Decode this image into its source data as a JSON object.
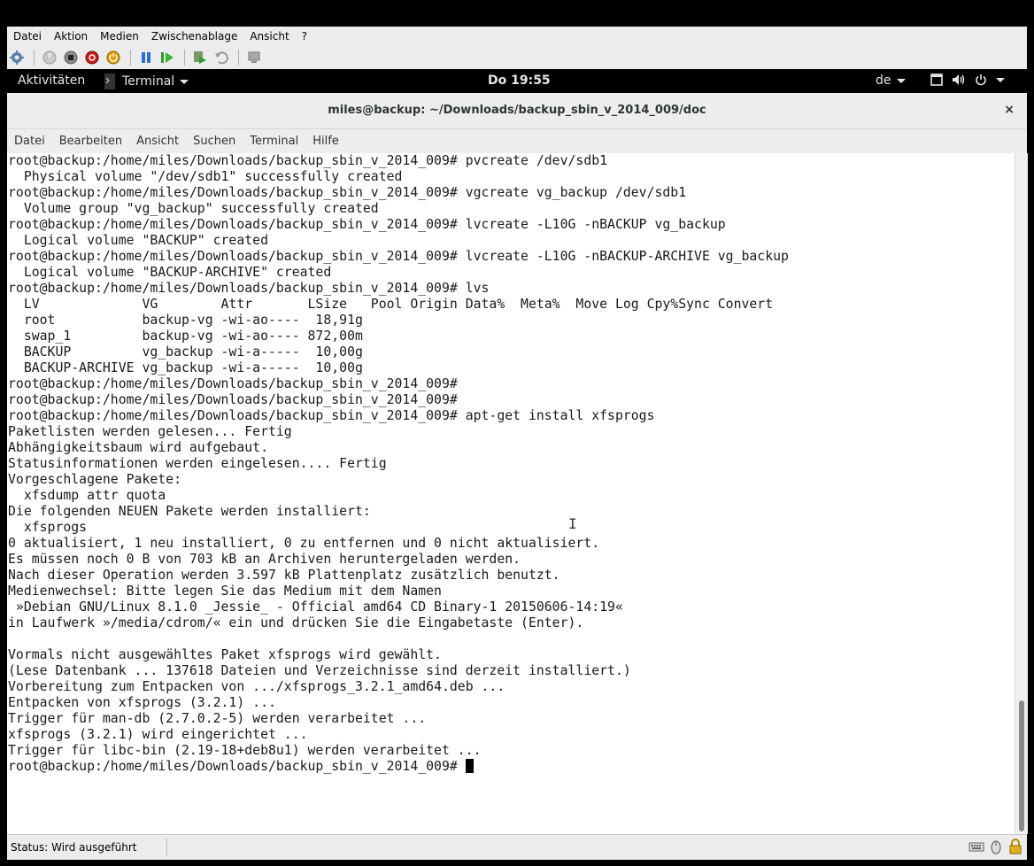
{
  "vm": {
    "menu": [
      "Datei",
      "Aktion",
      "Medien",
      "Zwischenablage",
      "Ansicht",
      "?"
    ],
    "toolbar_icons": [
      "settings-icon",
      "start-icon",
      "stop-icon",
      "shutdown-icon",
      "power-icon",
      "pause-icon",
      "resume-icon",
      "checkpoint-icon",
      "revert-icon",
      "share-icon"
    ],
    "status": "Status: Wird ausgeführt"
  },
  "gnome": {
    "activities": "Aktivitäten",
    "app_menu": "Terminal",
    "clock": "Do 19:55",
    "keyboard_layout": "de"
  },
  "window": {
    "title": "miles@backup: ~/Downloads/backup_sbin_v_2014_009/doc",
    "close": "×"
  },
  "terminal": {
    "menu": [
      "Datei",
      "Bearbeiten",
      "Ansicht",
      "Suchen",
      "Terminal",
      "Hilfe"
    ],
    "lines": [
      "root@backup:/home/miles/Downloads/backup_sbin_v_2014_009# pvcreate /dev/sdb1",
      "  Physical volume \"/dev/sdb1\" successfully created",
      "root@backup:/home/miles/Downloads/backup_sbin_v_2014_009# vgcreate vg_backup /dev/sdb1",
      "  Volume group \"vg_backup\" successfully created",
      "root@backup:/home/miles/Downloads/backup_sbin_v_2014_009# lvcreate -L10G -nBACKUP vg_backup",
      "  Logical volume \"BACKUP\" created",
      "root@backup:/home/miles/Downloads/backup_sbin_v_2014_009# lvcreate -L10G -nBACKUP-ARCHIVE vg_backup",
      "  Logical volume \"BACKUP-ARCHIVE\" created",
      "root@backup:/home/miles/Downloads/backup_sbin_v_2014_009# lvs",
      "  LV             VG        Attr       LSize   Pool Origin Data%  Meta%  Move Log Cpy%Sync Convert",
      "  root           backup-vg -wi-ao----  18,91g",
      "  swap_1         backup-vg -wi-ao---- 872,00m",
      "  BACKUP         vg_backup -wi-a-----  10,00g",
      "  BACKUP-ARCHIVE vg_backup -wi-a-----  10,00g",
      "root@backup:/home/miles/Downloads/backup_sbin_v_2014_009#",
      "root@backup:/home/miles/Downloads/backup_sbin_v_2014_009#",
      "root@backup:/home/miles/Downloads/backup_sbin_v_2014_009# apt-get install xfsprogs",
      "Paketlisten werden gelesen... Fertig",
      "Abhängigkeitsbaum wird aufgebaut.",
      "Statusinformationen werden eingelesen.... Fertig",
      "Vorgeschlagene Pakete:",
      "  xfsdump attr quota",
      "Die folgenden NEUEN Pakete werden installiert:",
      "  xfsprogs",
      "0 aktualisiert, 1 neu installiert, 0 zu entfernen und 0 nicht aktualisiert.",
      "Es müssen noch 0 B von 703 kB an Archiven heruntergeladen werden.",
      "Nach dieser Operation werden 3.597 kB Plattenplatz zusätzlich benutzt.",
      "Medienwechsel: Bitte legen Sie das Medium mit dem Namen",
      " »Debian GNU/Linux 8.1.0 _Jessie_ - Official amd64 CD Binary-1 20150606-14:19«",
      "in Laufwerk »/media/cdrom/« ein und drücken Sie die Eingabetaste (Enter).",
      "",
      "Vormals nicht ausgewähltes Paket xfsprogs wird gewählt.",
      "(Lese Datenbank ... 137618 Dateien und Verzeichnisse sind derzeit installiert.)",
      "Vorbereitung zum Entpacken von .../xfsprogs_3.2.1_amd64.deb ...",
      "Entpacken von xfsprogs (3.2.1) ...",
      "Trigger für man-db (2.7.0.2-5) werden verarbeitet ...",
      "xfsprogs (3.2.1) wird eingerichtet ...",
      "Trigger für libc-bin (2.19-18+deb8u1) werden verarbeitet ..."
    ],
    "prompt": "root@backup:/home/miles/Downloads/backup_sbin_v_2014_009# "
  }
}
